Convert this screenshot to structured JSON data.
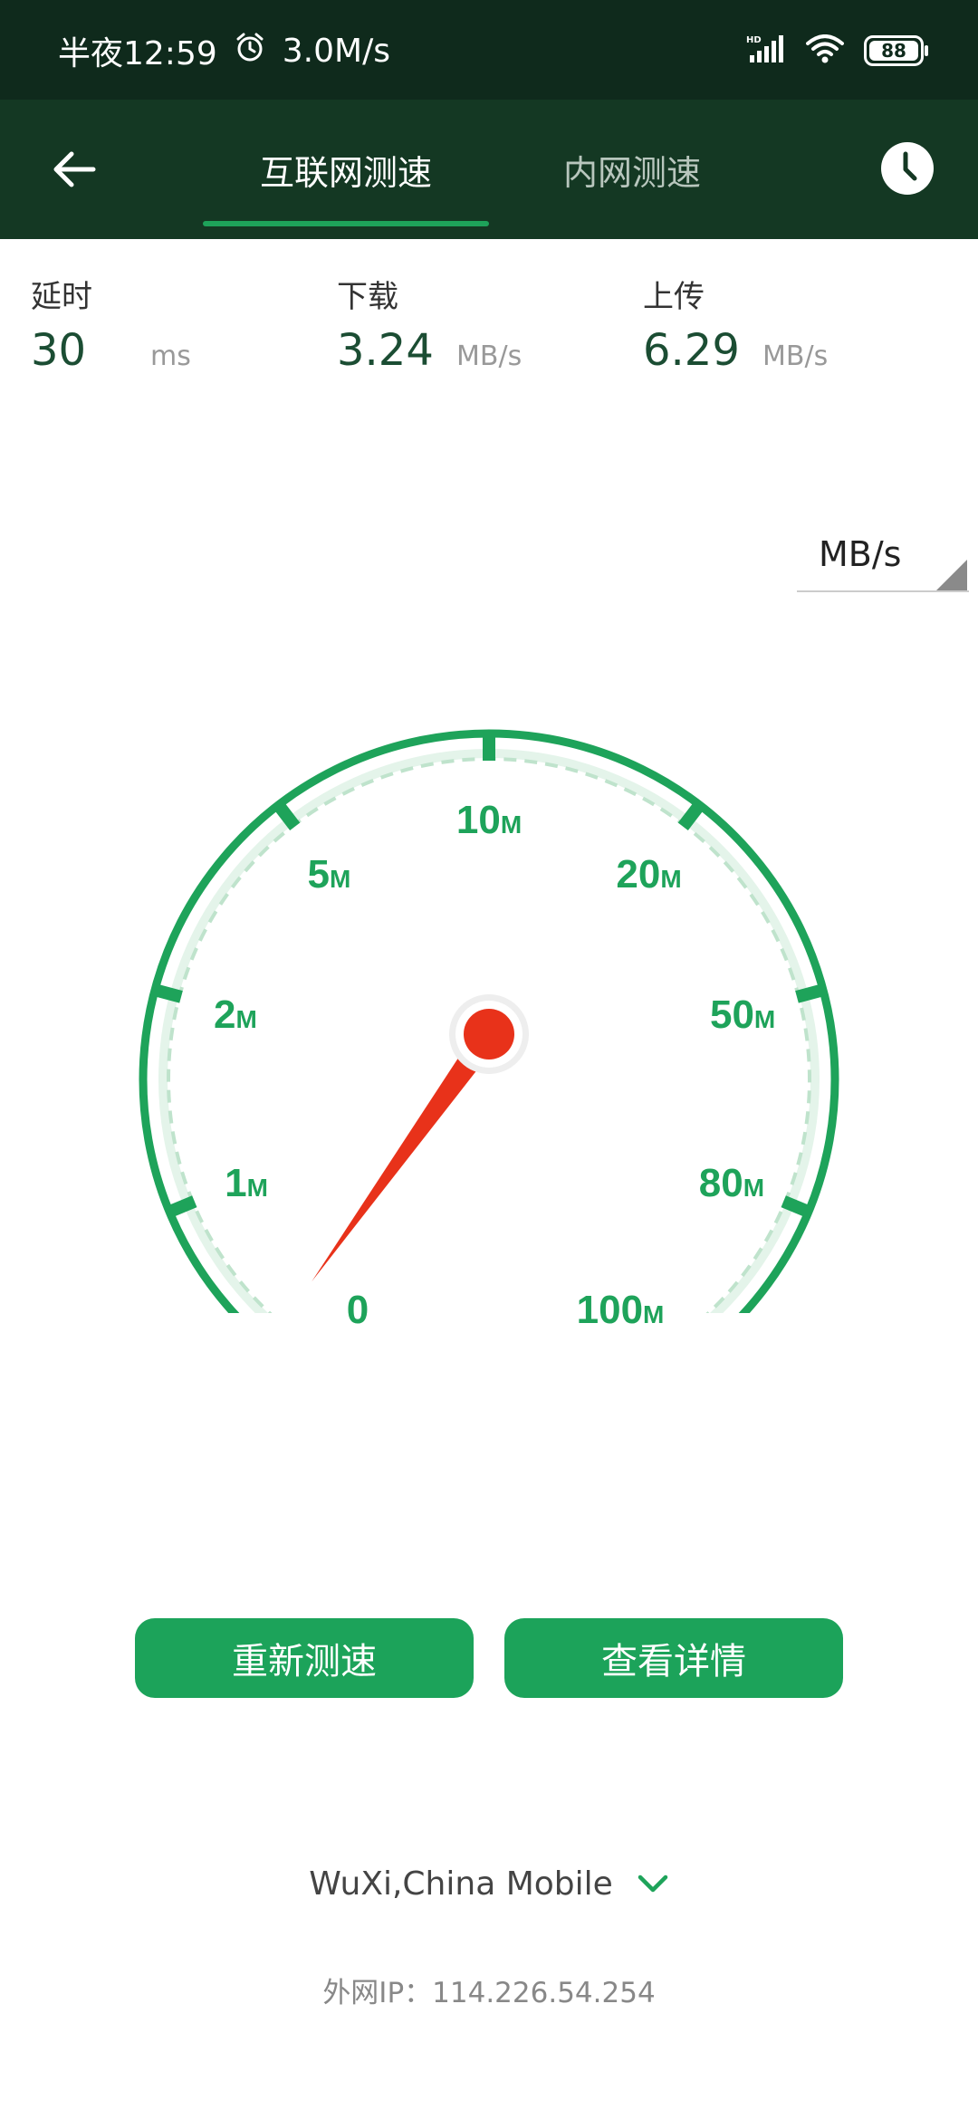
{
  "status_bar": {
    "time": "半夜12:59",
    "net_speed": "3.0M/s",
    "battery": "88"
  },
  "tabs": [
    {
      "label": "互联网测速",
      "active": true
    },
    {
      "label": "内网测速",
      "active": false
    }
  ],
  "stats": [
    {
      "label": "延时",
      "value": "30",
      "unit": "ms"
    },
    {
      "label": "下载",
      "value": "3.24",
      "unit": "MB/s"
    },
    {
      "label": "上传",
      "value": "6.29",
      "unit": "MB/s"
    }
  ],
  "unit_selector": {
    "value": "MB/s"
  },
  "gauge": {
    "ticks": [
      {
        "num": "0",
        "suffix": ""
      },
      {
        "num": "1",
        "suffix": "M"
      },
      {
        "num": "2",
        "suffix": "M"
      },
      {
        "num": "5",
        "suffix": "M"
      },
      {
        "num": "10",
        "suffix": "M"
      },
      {
        "num": "20",
        "suffix": "M"
      },
      {
        "num": "50",
        "suffix": "M"
      },
      {
        "num": "80",
        "suffix": "M"
      },
      {
        "num": "100",
        "suffix": "M"
      }
    ],
    "needle_value_mb": 0.3,
    "colors": {
      "arc": "#1ea35a",
      "needle": "#e8321a",
      "label": "#1ea35a"
    }
  },
  "buttons": {
    "retest": "重新测速",
    "details": "查看详情"
  },
  "location": {
    "text": "WuXi,China Mobile"
  },
  "ip": {
    "text": "外网IP：114.226.54.254"
  }
}
